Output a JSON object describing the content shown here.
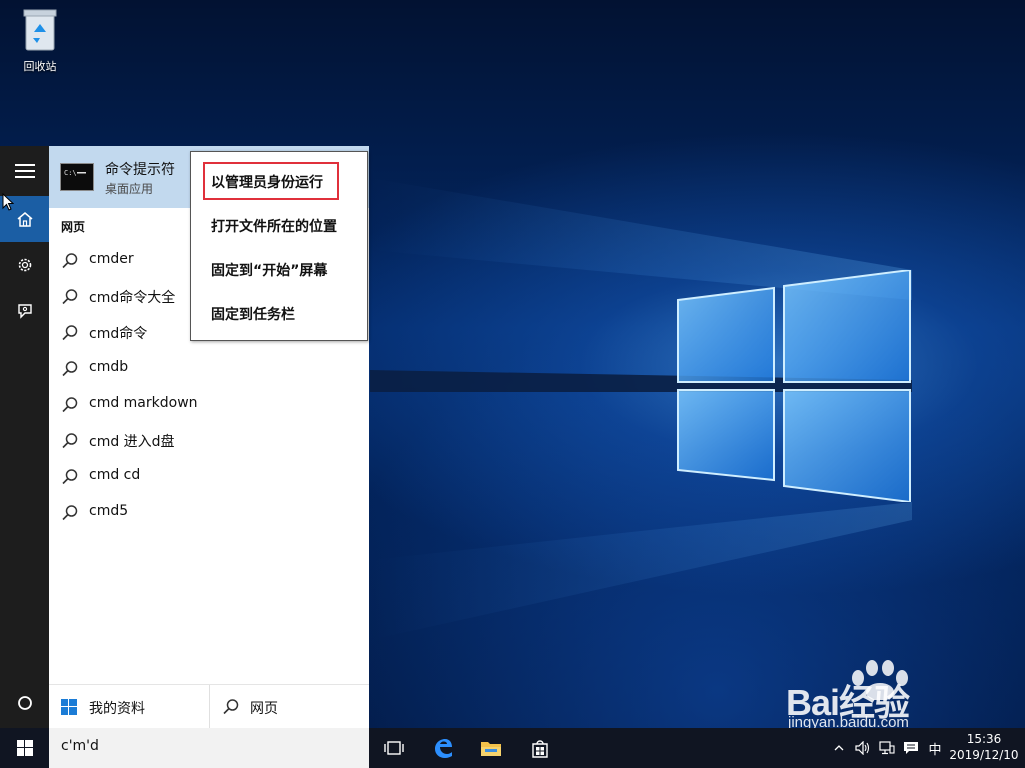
{
  "desktop": {
    "recycle_bin_label": "回收站"
  },
  "start_rail": {
    "items": [
      {
        "icon": "hamburger-icon"
      },
      {
        "icon": "home-icon",
        "active": true
      },
      {
        "icon": "gear-icon"
      },
      {
        "icon": "feedback-icon"
      }
    ],
    "power_icon": "power-icon"
  },
  "best_match": {
    "app_name": "命令提示符",
    "app_type": "桌面应用",
    "icon": "cmd-icon"
  },
  "web_section": {
    "title": "网页",
    "suggestions": [
      "cmder",
      "cmd命令大全",
      "cmd命令",
      "cmdb",
      "cmd markdown",
      "cmd 进入d盘",
      "cmd cd",
      "cmd5"
    ]
  },
  "bottom_bar": {
    "my_stuff_label": "我的资料",
    "web_label": "网页"
  },
  "context_menu": {
    "items": [
      "以管理员身份运行",
      "打开文件所在的位置",
      "固定到“开始”屏幕",
      "固定到任务栏"
    ],
    "highlighted_index": 0,
    "highlight_color": "#e0303b"
  },
  "taskbar": {
    "search_value": "c'm'd",
    "pinned": [
      "task-view-icon",
      "edge-icon",
      "file-explorer-icon",
      "store-icon"
    ],
    "tray": {
      "chevron_icon": "chevron-up-icon",
      "volume_icon": "volume-icon",
      "network_icon": "network-icon",
      "notification_icon": "notification-icon",
      "ime_label": "中"
    },
    "time": "15:36",
    "date": "2019/12/10"
  },
  "watermark": {
    "main": "Bai经验",
    "sub": "jingyan.baidu.com"
  },
  "colors": {
    "accent": "#1b5ea4",
    "best_match_bg": "#c2d9ee",
    "taskbar_bg": "#101522"
  }
}
